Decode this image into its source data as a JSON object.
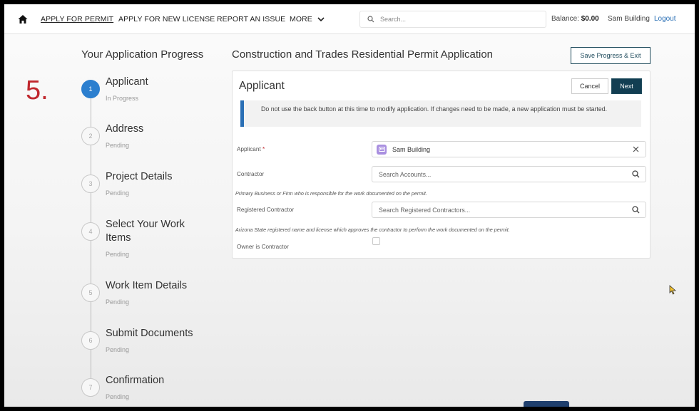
{
  "nav": {
    "links": [
      {
        "label": "APPLY FOR PERMIT"
      },
      {
        "label": "APPLY FOR NEW LICENSE"
      },
      {
        "label": "REPORT AN ISSUE"
      },
      {
        "label": "MORE"
      }
    ],
    "search_placeholder": "Search...",
    "balance_label": "Balance:",
    "balance_value": "$0.00",
    "user_name": "Sam Building",
    "logout_label": "Logout"
  },
  "step_marker": "5.",
  "progress": {
    "title": "Your Application Progress",
    "steps": [
      {
        "number": "1",
        "label": "Applicant",
        "status": "In Progress"
      },
      {
        "number": "2",
        "label": "Address",
        "status": "Pending"
      },
      {
        "number": "3",
        "label": "Project Details",
        "status": "Pending"
      },
      {
        "number": "4",
        "label": "Select Your Work Items",
        "status": "Pending"
      },
      {
        "number": "5",
        "label": "Work Item Details",
        "status": "Pending"
      },
      {
        "number": "6",
        "label": "Submit Documents",
        "status": "Pending"
      },
      {
        "number": "7",
        "label": "Confirmation",
        "status": "Pending"
      }
    ]
  },
  "main": {
    "title": "Construction and Trades Residential Permit Application",
    "save_exit_label": "Save Progress & Exit",
    "card": {
      "title": "Applicant",
      "cancel_label": "Cancel",
      "next_label": "Next",
      "notice": "Do not use the back button at this time to modify application. If changes need to be made, a new application must be started.",
      "fields": {
        "applicant_label": "Applicant",
        "applicant_required": "*",
        "applicant_value": "Sam Building",
        "contractor_label": "Contractor",
        "contractor_placeholder": "Search Accounts...",
        "contractor_help": "Primary Business or Firm who is responsible for the work documented on the permit.",
        "registered_label": "Registered Contractor",
        "registered_placeholder": "Search Registered Contractors...",
        "registered_help": "Arizona State registered name and license which approves the contractor to perform the work documented on the permit.",
        "owner_label": "Owner is Contractor",
        "owner_checked": false
      }
    }
  },
  "colors": {
    "accent": "#2a6fb5",
    "active_step": "#2c7fcf",
    "primary_button": "#123e52",
    "marker": "#c0282e"
  },
  "icons": [
    "home-icon",
    "chevron-down-icon",
    "search-icon",
    "contact-card-icon",
    "close-icon",
    "magnifier-icon",
    "mouse-cursor-icon"
  ]
}
